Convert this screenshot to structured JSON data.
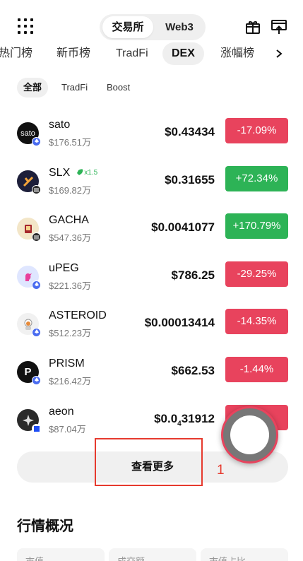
{
  "header": {
    "segments": [
      "交易所",
      "Web3"
    ],
    "icons": [
      "grid-menu-icon",
      "gift-icon",
      "exchange-icon"
    ]
  },
  "category_tabs": [
    "热门榜",
    "新币榜",
    "TradFi",
    "DEX",
    "涨幅榜"
  ],
  "sub_tabs": [
    "全部",
    "TradFi",
    "Boost"
  ],
  "tokens": [
    {
      "name": "sato",
      "market_cap": "$176.51万",
      "price": "$0.43434",
      "change": "-17.09%",
      "direction": "down",
      "chain": "ethereum"
    },
    {
      "name": "SLX",
      "market_cap": "$169.82万",
      "price": "$0.31655",
      "change": "+72.34%",
      "direction": "up",
      "chain": "other",
      "boost": "x1.5"
    },
    {
      "name": "GACHA",
      "market_cap": "$547.36万",
      "price": "$0.0041077",
      "change": "+170.79%",
      "direction": "up",
      "chain": "other"
    },
    {
      "name": "uPEG",
      "market_cap": "$221.36万",
      "price": "$786.25",
      "change": "-29.25%",
      "direction": "down",
      "chain": "ethereum"
    },
    {
      "name": "ASTEROID",
      "market_cap": "$512.23万",
      "price": "$0.00013414",
      "change": "-14.35%",
      "direction": "down",
      "chain": "ethereum"
    },
    {
      "name": "PRISM",
      "market_cap": "$216.42万",
      "price": "$662.53",
      "change": "-1.44%",
      "direction": "down",
      "chain": "ethereum"
    },
    {
      "name": "aeon",
      "market_cap": "$87.04万",
      "price_main": "$0.0",
      "price_sub": "4",
      "price_rest": "31912",
      "change": "",
      "direction": "down",
      "chain": "base"
    }
  ],
  "see_more_label": "查看更多",
  "annotation_number": "1",
  "market_overview": {
    "title": "行情概况",
    "cards": [
      "市值",
      "成交额",
      "市值占比"
    ]
  },
  "colors": {
    "down": "#e8435d",
    "up": "#2db356",
    "annotation": "#e63a2e"
  }
}
